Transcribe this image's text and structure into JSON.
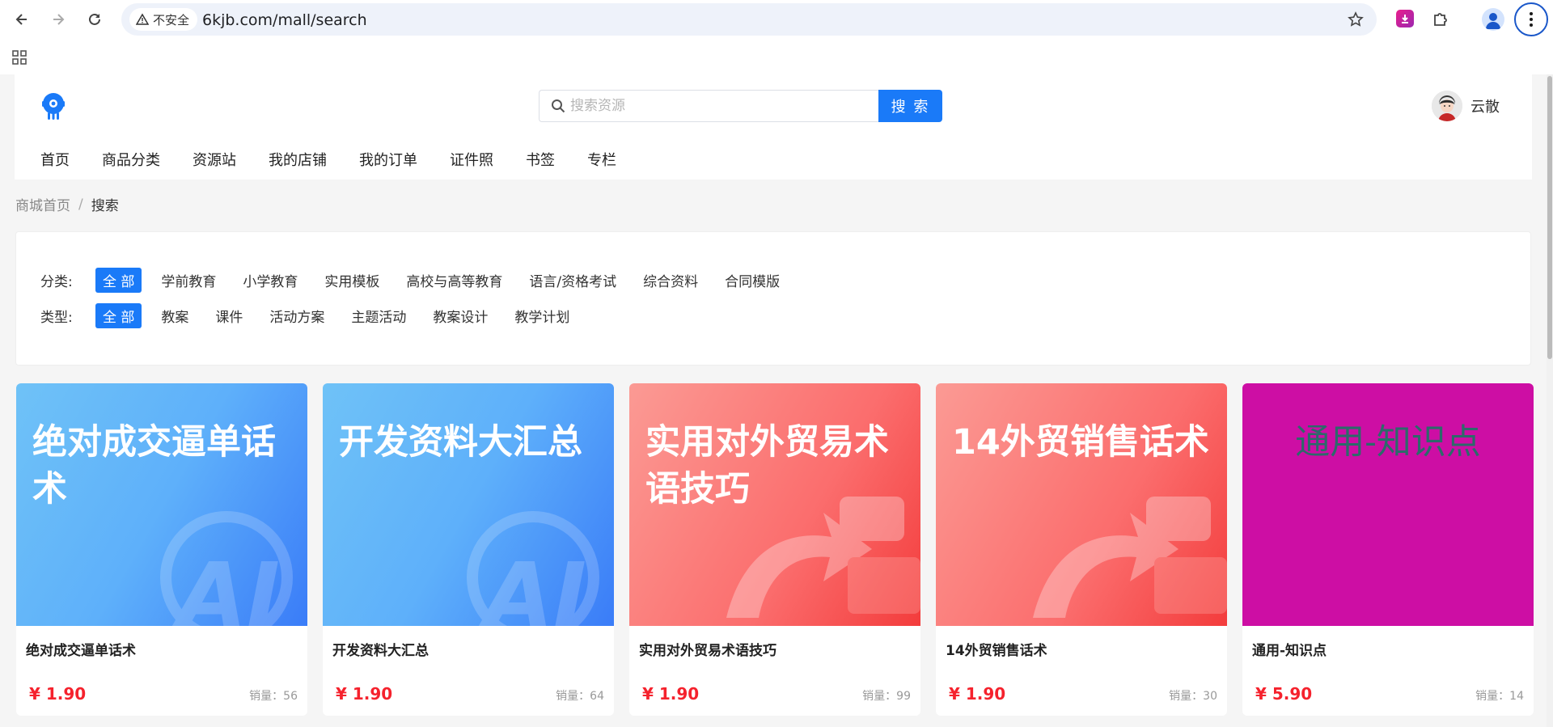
{
  "browser": {
    "security_label": "不安全",
    "url": "6kjb.com/mall/search"
  },
  "header": {
    "search_placeholder": "搜索资源",
    "search_button": "搜 索",
    "username": "云散",
    "nav": [
      "首页",
      "商品分类",
      "资源站",
      "我的店铺",
      "我的订单",
      "证件照",
      "书签",
      "专栏"
    ]
  },
  "breadcrumb": {
    "home": "商城首页",
    "separator": "/",
    "current": "搜索"
  },
  "filters": {
    "category": {
      "label": "分类:",
      "options": [
        "全 部",
        "学前教育",
        "小学教育",
        "实用模板",
        "高校与高等教育",
        "语言/资格考试",
        "综合资料",
        "合同模版"
      ],
      "selected": "全 部"
    },
    "type": {
      "label": "类型:",
      "options": [
        "全 部",
        "教案",
        "课件",
        "活动方案",
        "主题活动",
        "教案设计",
        "教学计划"
      ],
      "selected": "全 部"
    }
  },
  "products": [
    {
      "thumb_text": "绝对成交逼单话术",
      "theme": "blue",
      "name": "绝对成交逼单话术",
      "price": "¥ 1.90",
      "sales": "销量：56"
    },
    {
      "thumb_text": "开发资料大汇总",
      "theme": "blue",
      "name": "开发资料大汇总",
      "price": "¥ 1.90",
      "sales": "销量：64"
    },
    {
      "thumb_text": "实用对外贸易术语技巧",
      "theme": "red",
      "name": "实用对外贸易术语技巧",
      "price": "¥ 1.90",
      "sales": "销量：99"
    },
    {
      "thumb_text": "14外贸销售话术",
      "theme": "red",
      "name": "14外贸销售话术",
      "price": "¥ 1.90",
      "sales": "销量：30"
    },
    {
      "thumb_text": "通用-知识点",
      "theme": "magenta",
      "name": "通用-知识点",
      "price": "¥ 5.90",
      "sales": "销量：14"
    }
  ],
  "colors": {
    "primary": "#1a7af8",
    "price": "#f5222d"
  }
}
